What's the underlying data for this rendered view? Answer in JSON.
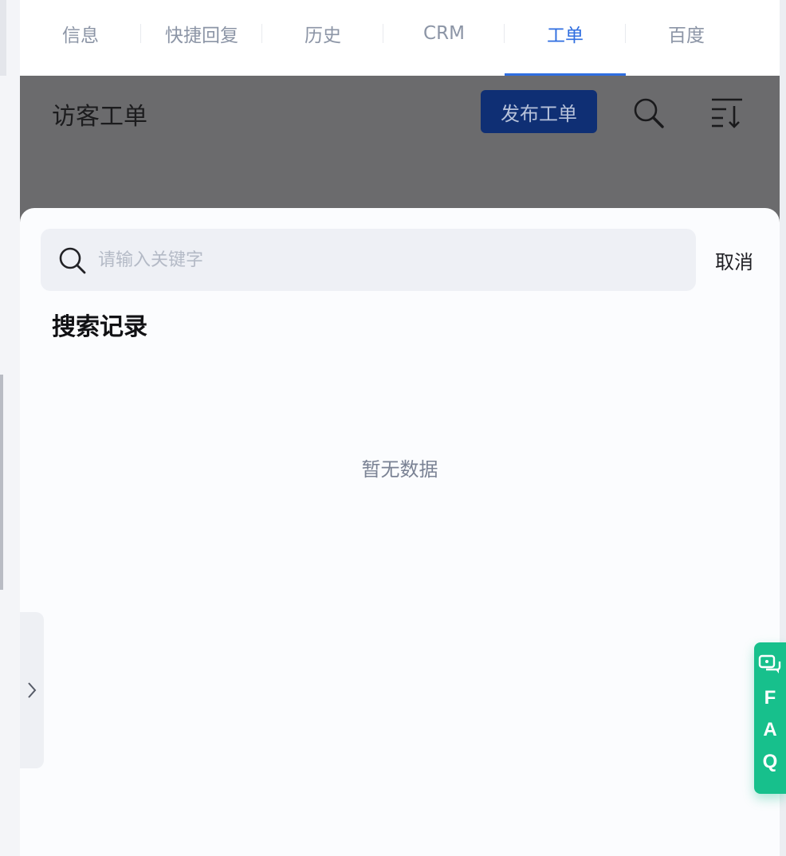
{
  "tabs": [
    {
      "label": "信息",
      "active": false
    },
    {
      "label": "快捷回复",
      "active": false
    },
    {
      "label": "历史",
      "active": false
    },
    {
      "label": "CRM",
      "active": false
    },
    {
      "label": "工单",
      "active": true
    },
    {
      "label": "百度",
      "active": false
    }
  ],
  "header": {
    "title": "访客工单",
    "publish_label": "发布工单",
    "search_icon": "search-icon",
    "sort_icon": "sort-icon"
  },
  "search": {
    "placeholder": "请输入关键字",
    "value": "",
    "cancel_label": "取消"
  },
  "history": {
    "title": "搜索记录",
    "empty_text": "暂无数据"
  },
  "faq": {
    "letters": [
      "F",
      "A",
      "Q"
    ],
    "icon": "chat-bubbles-icon"
  },
  "colors": {
    "accent": "#2f6ee0",
    "publish_button": "#0f2f74",
    "faq_green": "#17c08c",
    "overlay": "#6b6b6d"
  }
}
